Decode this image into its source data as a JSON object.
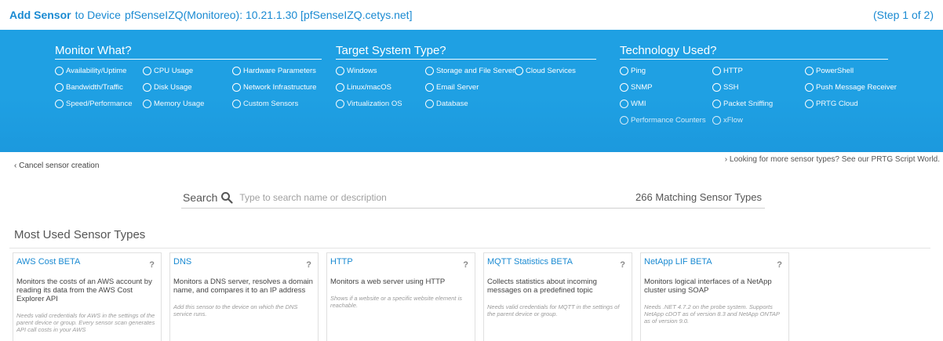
{
  "header": {
    "title_strong": "Add Sensor",
    "title_mid": "to Device",
    "device": "pfSenseIZQ(Monitoreo): 10.21.1.30 [pfSenseIZQ.cetys.net]",
    "step": "(Step 1 of 2)"
  },
  "filters": {
    "monitor": {
      "title": "Monitor What?",
      "options": [
        "Availability/Uptime",
        "CPU Usage",
        "Hardware Parameters",
        "Bandwidth/Traffic",
        "Disk Usage",
        "Network Infrastructure",
        "Speed/Performance",
        "Memory Usage",
        "Custom Sensors"
      ]
    },
    "target": {
      "title": "Target System Type?",
      "options": [
        "Windows",
        "Storage and File Server",
        "Cloud Services",
        "Linux/macOS",
        "Email Server",
        "Virtualization OS",
        "Database"
      ]
    },
    "technology": {
      "title": "Technology Used?",
      "options": [
        "Ping",
        "HTTP",
        "PowerShell",
        "SNMP",
        "SSH",
        "Push Message Receiver",
        "WMI",
        "Packet Sniffing",
        "PRTG Cloud",
        "Performance Counters",
        "xFlow"
      ]
    }
  },
  "links": {
    "cancel": "Cancel sensor creation",
    "more": "Looking for more sensor types? See our PRTG Script World."
  },
  "search": {
    "label": "Search",
    "placeholder": "Type to search name or description",
    "match_count": "266",
    "match_label": "Matching Sensor Types"
  },
  "section": {
    "title": "Most Used Sensor Types"
  },
  "cards": [
    {
      "title": "AWS Cost BETA",
      "desc": "Monitors the costs of an AWS account by reading its data from the AWS Cost Explorer API",
      "note": "Needs valid credentials for AWS in the settings of the parent device or group. Every sensor scan generates API call costs in your AWS"
    },
    {
      "title": "DNS",
      "desc": "Monitors a DNS server, resolves a domain name, and compares it to an IP address",
      "note": "Add this sensor to the device on which the DNS service runs."
    },
    {
      "title": "HTTP",
      "desc": "Monitors a web server using HTTP",
      "note": "Shows if a website or a specific website element is reachable."
    },
    {
      "title": "MQTT Statistics BETA",
      "desc": "Collects statistics about incoming messages on a predefined topic",
      "note": "Needs valid credentials for MQTT in the settings of the parent device or group."
    },
    {
      "title": "NetApp LIF BETA",
      "desc": "Monitors logical interfaces of a NetApp cluster using SOAP",
      "note": "Needs .NET 4.7.2 on the probe system. Supports NetApp cDOT as of version 8.3 and NetApp ONTAP as of version 9.0."
    }
  ],
  "card_help_label": "?",
  "colors": {
    "panel_blue": "#1fa0e3",
    "link_blue": "#1a8ad2"
  },
  "icons": {
    "search": "search-icon",
    "radio": "radio-empty-icon",
    "chevron": "chevron-left-icon"
  }
}
